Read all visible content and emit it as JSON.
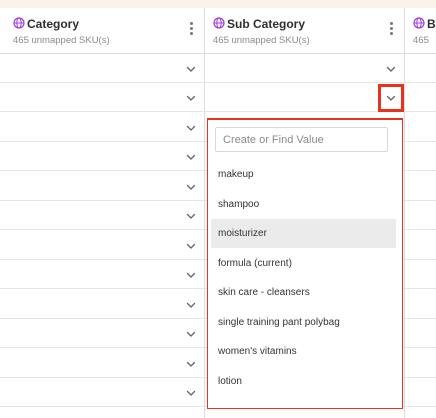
{
  "colors": {
    "accent_purple": "#a23bd6",
    "highlight_red": "#e8321c",
    "selected_bg": "#ebebeb"
  },
  "columns": [
    {
      "title": "Category",
      "subtitle": "465 unmapped SKU(s)",
      "icon": "globe-icon"
    },
    {
      "title": "Sub Category",
      "subtitle": "465 unmapped SKU(s)",
      "icon": "globe-icon"
    },
    {
      "title": "Br",
      "subtitle": "465",
      "icon": "globe-icon"
    }
  ],
  "dropdown": {
    "search_placeholder": "Create or Find Value",
    "options": [
      {
        "label": "makeup",
        "selected": false
      },
      {
        "label": "shampoo",
        "selected": false
      },
      {
        "label": "moisturizer",
        "selected": true
      },
      {
        "label": "formula (current)",
        "selected": false
      },
      {
        "label": "skin care - cleansers",
        "selected": false
      },
      {
        "label": "single training pant polybag",
        "selected": false
      },
      {
        "label": "women's vitamins",
        "selected": false
      },
      {
        "label": "lotion",
        "selected": false
      }
    ]
  }
}
